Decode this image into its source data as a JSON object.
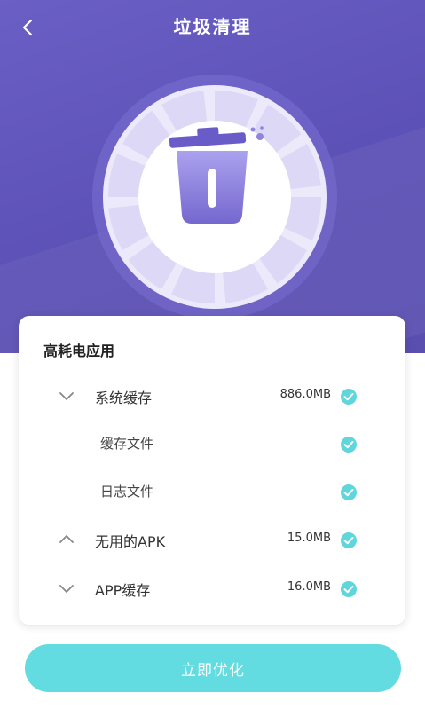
{
  "header": {
    "title": "垃圾清理"
  },
  "card": {
    "title": "高耗电应用",
    "rows": [
      {
        "label": "系统缓存",
        "size": "886.0MB"
      },
      {
        "label": "缓存文件"
      },
      {
        "label": "日志文件"
      },
      {
        "label": "无用的APK",
        "size": "15.0MB"
      },
      {
        "label": "APP缓存",
        "size": "16.0MB"
      }
    ]
  },
  "action": {
    "optimize_label": "立即优化"
  },
  "colors": {
    "header_purple": "#5c51b6",
    "check_teal": "#5fd6dc",
    "button_teal": "#62dce1"
  },
  "icons": {
    "back": "chevron-left-icon",
    "trash": "trash-can-icon",
    "expand": "chevron-down-icon",
    "collapse": "chevron-up-icon",
    "check": "check-circle-icon"
  }
}
